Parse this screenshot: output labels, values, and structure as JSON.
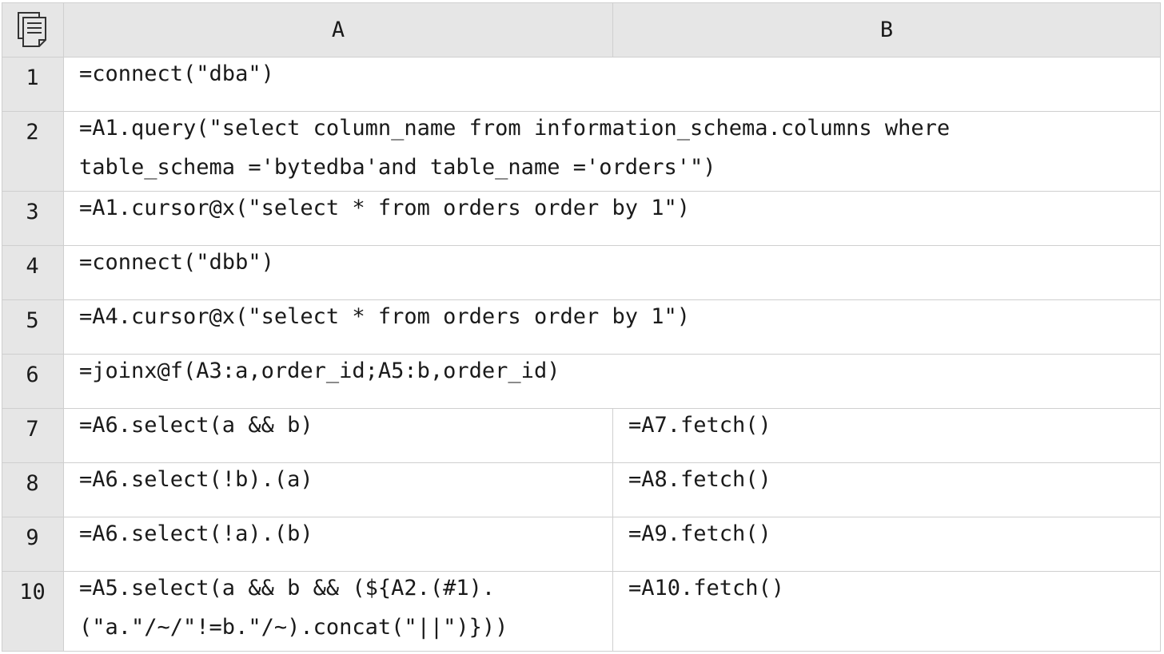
{
  "columns": [
    {
      "label": "A"
    },
    {
      "label": "B"
    }
  ],
  "rows": [
    {
      "num": "1",
      "a": "=connect(\"dba\")",
      "b": null
    },
    {
      "num": "2",
      "a": "=A1.query(\"select column_name from information_schema.columns where table_schema ='bytedba'and table_name ='orders'\")",
      "b": null
    },
    {
      "num": "3",
      "a": "=A1.cursor@x(\"select * from orders order by 1\")",
      "b": null
    },
    {
      "num": "4",
      "a": "=connect(\"dbb\")",
      "b": null
    },
    {
      "num": "5",
      "a": "=A4.cursor@x(\"select * from orders order by 1\")",
      "b": null
    },
    {
      "num": "6",
      "a": "=joinx@f(A3:a,order_id;A5:b,order_id)",
      "b": null
    },
    {
      "num": "7",
      "a": "=A6.select(a && b)",
      "b": "=A7.fetch()"
    },
    {
      "num": "8",
      "a": "=A6.select(!b).(a)",
      "b": "=A8.fetch()"
    },
    {
      "num": "9",
      "a": "=A6.select(!a).(b)",
      "b": "=A9.fetch()"
    },
    {
      "num": "10",
      "a": "=A5.select(a && b && (${A2.(#1).(\"a.\"/~/\"!=b.\"/~).concat(\"||\")}))",
      "b": "=A10.fetch()"
    }
  ],
  "corner": {
    "icon": "document-icon"
  },
  "colors": {
    "header_bg": "#e6e6e6",
    "grid": "#cfcfcf",
    "cell_bg": "#ffffff"
  }
}
